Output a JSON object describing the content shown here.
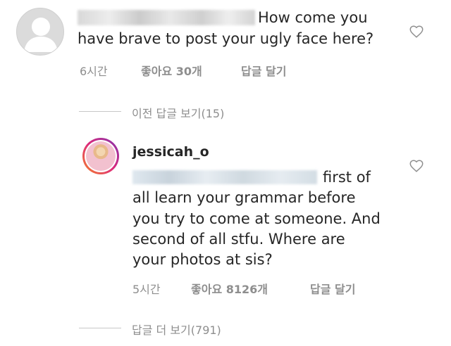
{
  "comment1": {
    "text_line1": "How come you",
    "text_line2": "have brave to post your ugly face here?",
    "time": "6시간",
    "likes": "좋아요 30개",
    "reply": "답글 달기"
  },
  "view_previous": "이전 답글 보기(15)",
  "comment2": {
    "username": "jessicah_o",
    "text_line1": "first of",
    "text_line2": "all learn your grammar before",
    "text_line3": "you try to come at someone. And",
    "text_line4": "second of all stfu. Where are",
    "text_line5": "your photos at sis?",
    "time": "5시간",
    "likes": "좋아요 8126개",
    "reply": "답글 달기"
  },
  "view_more": "답글 더 보기(791)",
  "colors": {
    "text": "#262626",
    "meta": "#8e8e8e",
    "divider": "#c7c7c7"
  },
  "icons": {
    "heart": "heart-outline-icon",
    "avatar": "user-placeholder-icon"
  }
}
